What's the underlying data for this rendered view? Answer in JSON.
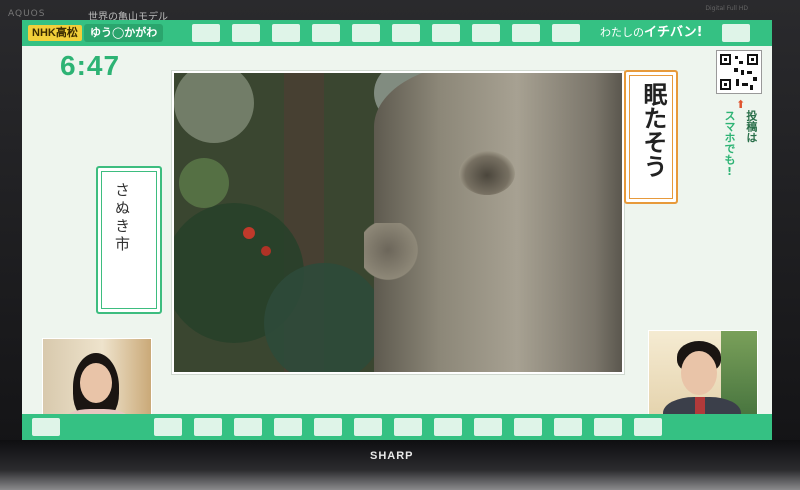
{
  "tv": {
    "top_brand": "AQUOS",
    "program_title": "世界の亀山モデル",
    "top_right_tag": "Digital Full HD",
    "bottom_brand": "SHARP"
  },
  "broadcast": {
    "station_logo": "NHK高松",
    "show_logo": "ゆう◯かがわ",
    "corner_title_prefix": "わたしの",
    "corner_title_main": "イチバン!",
    "clock": "6:47",
    "location_label": "さぬき市",
    "caption_label": "眠たそう",
    "post_line1": "投稿は",
    "post_line2": "スマホでも!"
  },
  "colors": {
    "film_green": "#35c183",
    "label_orange": "#e79a3b",
    "clock_green": "#2db374"
  },
  "icons": {
    "qr": "qr-code-icon",
    "arrow": "arrow-up-icon"
  }
}
